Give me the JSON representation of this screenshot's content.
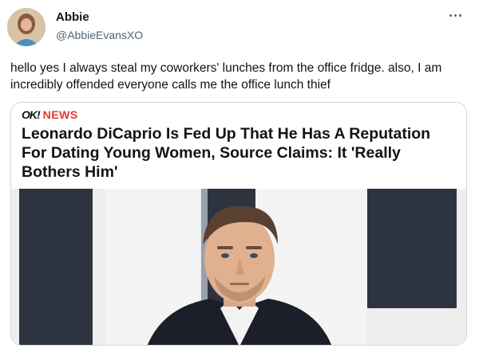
{
  "tweet": {
    "display_name": "Abbie",
    "handle": "@AbbieEvansXO",
    "text": "hello yes I always steal my coworkers' lunches from the office fridge. also, I am incredibly offended everyone calls me the office lunch thief"
  },
  "card": {
    "logo_ok": "OK!",
    "logo_news": "NEWS",
    "headline": "Leonardo DiCaprio Is Fed Up That He Has A Reputation For Dating Young Women, Source Claims: It 'Really Bothers Him'"
  },
  "icons": {
    "more": "more-icon",
    "avatar": "avatar"
  }
}
